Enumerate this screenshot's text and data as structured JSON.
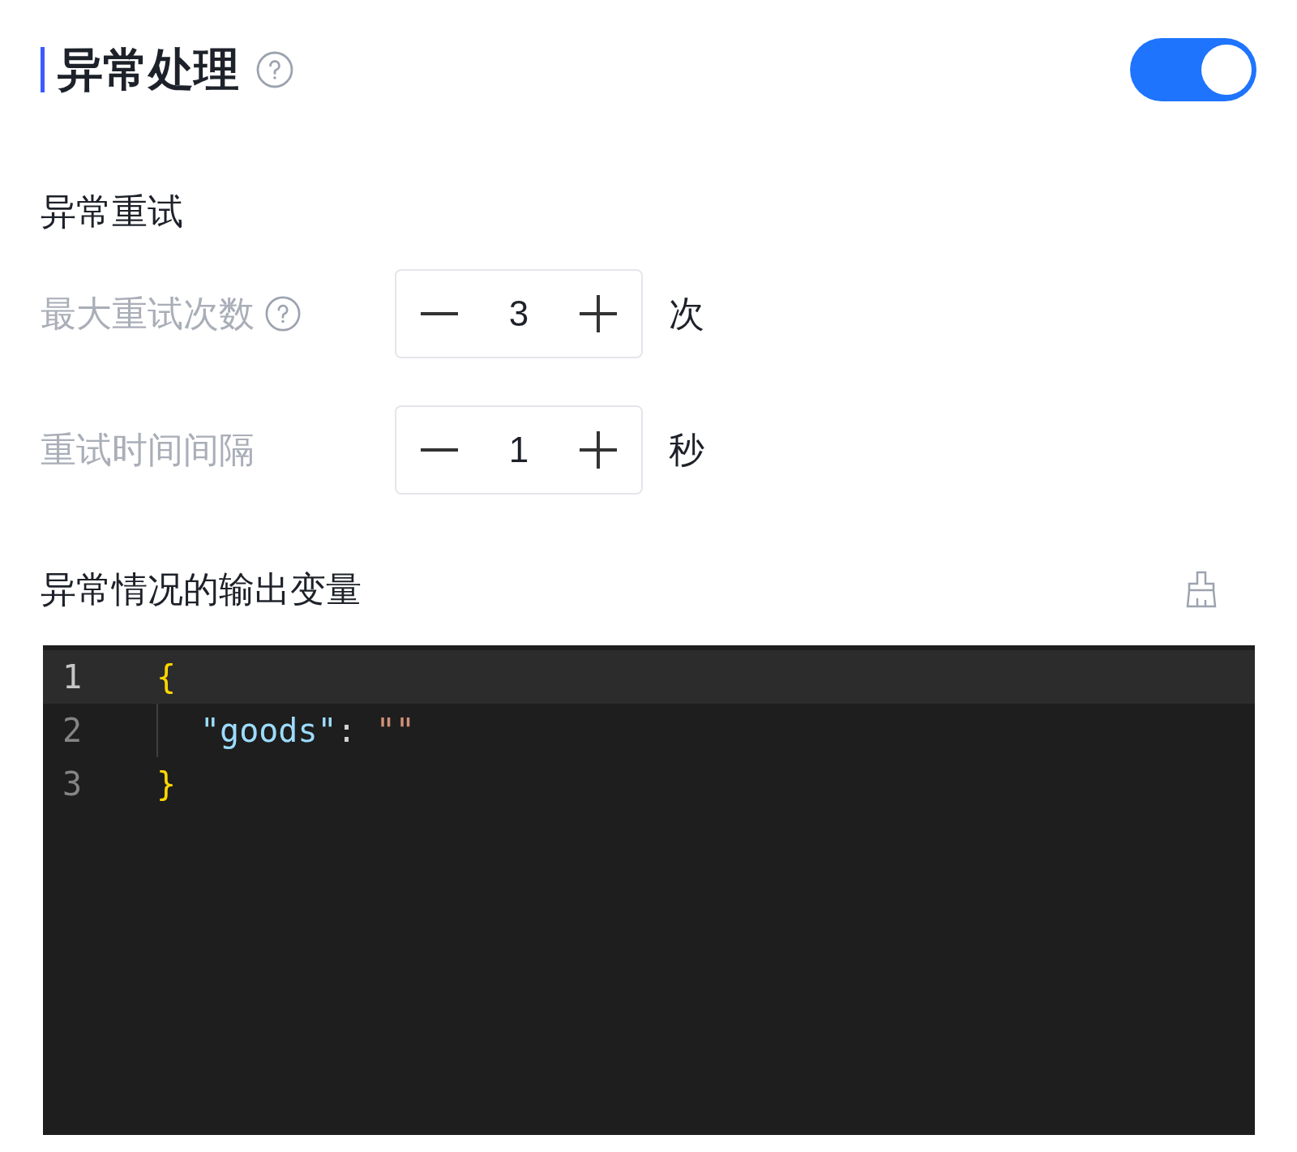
{
  "section": {
    "title": "异常处理",
    "enabled": true
  },
  "retry": {
    "heading": "异常重试",
    "fields": [
      {
        "label": "最大重试次数",
        "help": true,
        "value": "3",
        "unit": "次"
      },
      {
        "label": "重试时间间隔",
        "help": false,
        "value": "1",
        "unit": "秒"
      }
    ]
  },
  "output": {
    "heading": "异常情况的输出变量",
    "editor": {
      "lines": [
        {
          "number": "1",
          "selected": true,
          "indented": false,
          "tokens": [
            {
              "kind": "brace",
              "text": "{"
            }
          ]
        },
        {
          "number": "2",
          "selected": false,
          "indented": true,
          "tokens": [
            {
              "kind": "key",
              "text": "\"goods\""
            },
            {
              "kind": "punct",
              "text": ": "
            },
            {
              "kind": "string",
              "text": "\"\""
            }
          ]
        },
        {
          "number": "3",
          "selected": false,
          "indented": false,
          "tokens": [
            {
              "kind": "brace",
              "text": "}"
            }
          ]
        }
      ]
    }
  }
}
